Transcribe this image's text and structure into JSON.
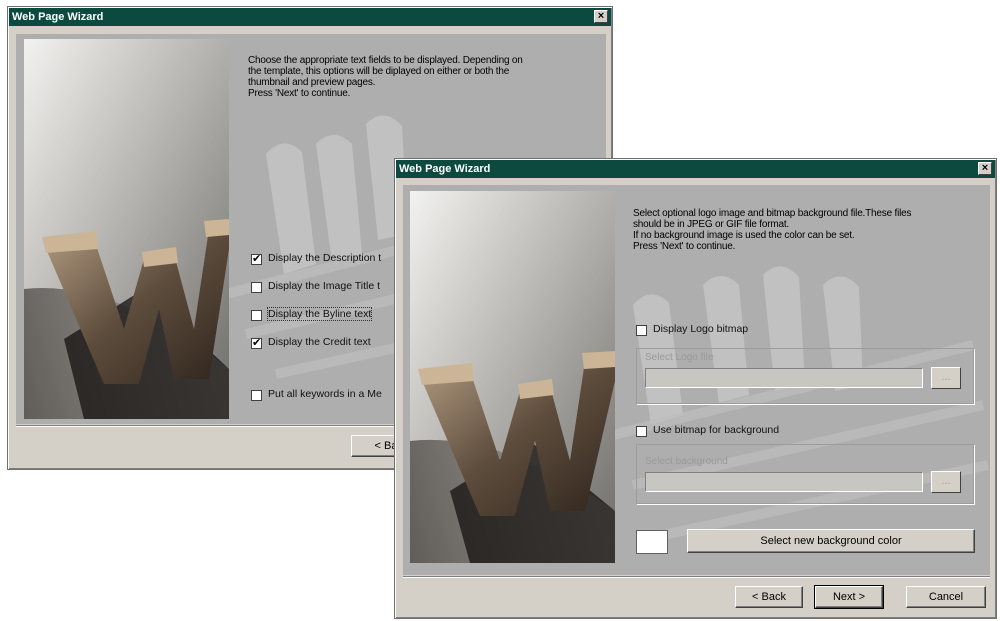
{
  "window1": {
    "title": "Web Page Wizard",
    "close_glyph": "×",
    "description": [
      "Choose the appropriate text fields to be displayed. Depending on",
      "the template, this options will be diplayed on either or both the",
      "thumbnail and preview pages.",
      " Press 'Next' to continue."
    ],
    "options": [
      {
        "label": "Display the Description t",
        "checked": true
      },
      {
        "label": "Display the Image Title t",
        "checked": false
      },
      {
        "label": "Display the Byline text",
        "checked": false
      },
      {
        "label": "Display the Credit text",
        "checked": true
      },
      {
        "label": "Put all keywords in a Me",
        "checked": false
      }
    ],
    "back_label": "< Ba"
  },
  "window2": {
    "title": "Web Page Wizard",
    "close_glyph": "×",
    "description": [
      "Select optional logo image and bitmap background file.These files",
      "should be in JPEG or GIF file format.",
      "If no background image is used the color can be set.",
      " Press 'Next' to continue."
    ],
    "logo": {
      "label": "Display Logo bitmap",
      "checked": false,
      "group_caption": "Select Logo file",
      "value": "",
      "browse": "..."
    },
    "background": {
      "label": "Use bitmap for background",
      "checked": false,
      "group_caption": "Select background",
      "value": "",
      "browse": "..."
    },
    "color_button": "Select new background color",
    "swatch_color": "#ffffff",
    "buttons": {
      "back": "< Back",
      "next": "Next >",
      "cancel": "Cancel"
    }
  }
}
